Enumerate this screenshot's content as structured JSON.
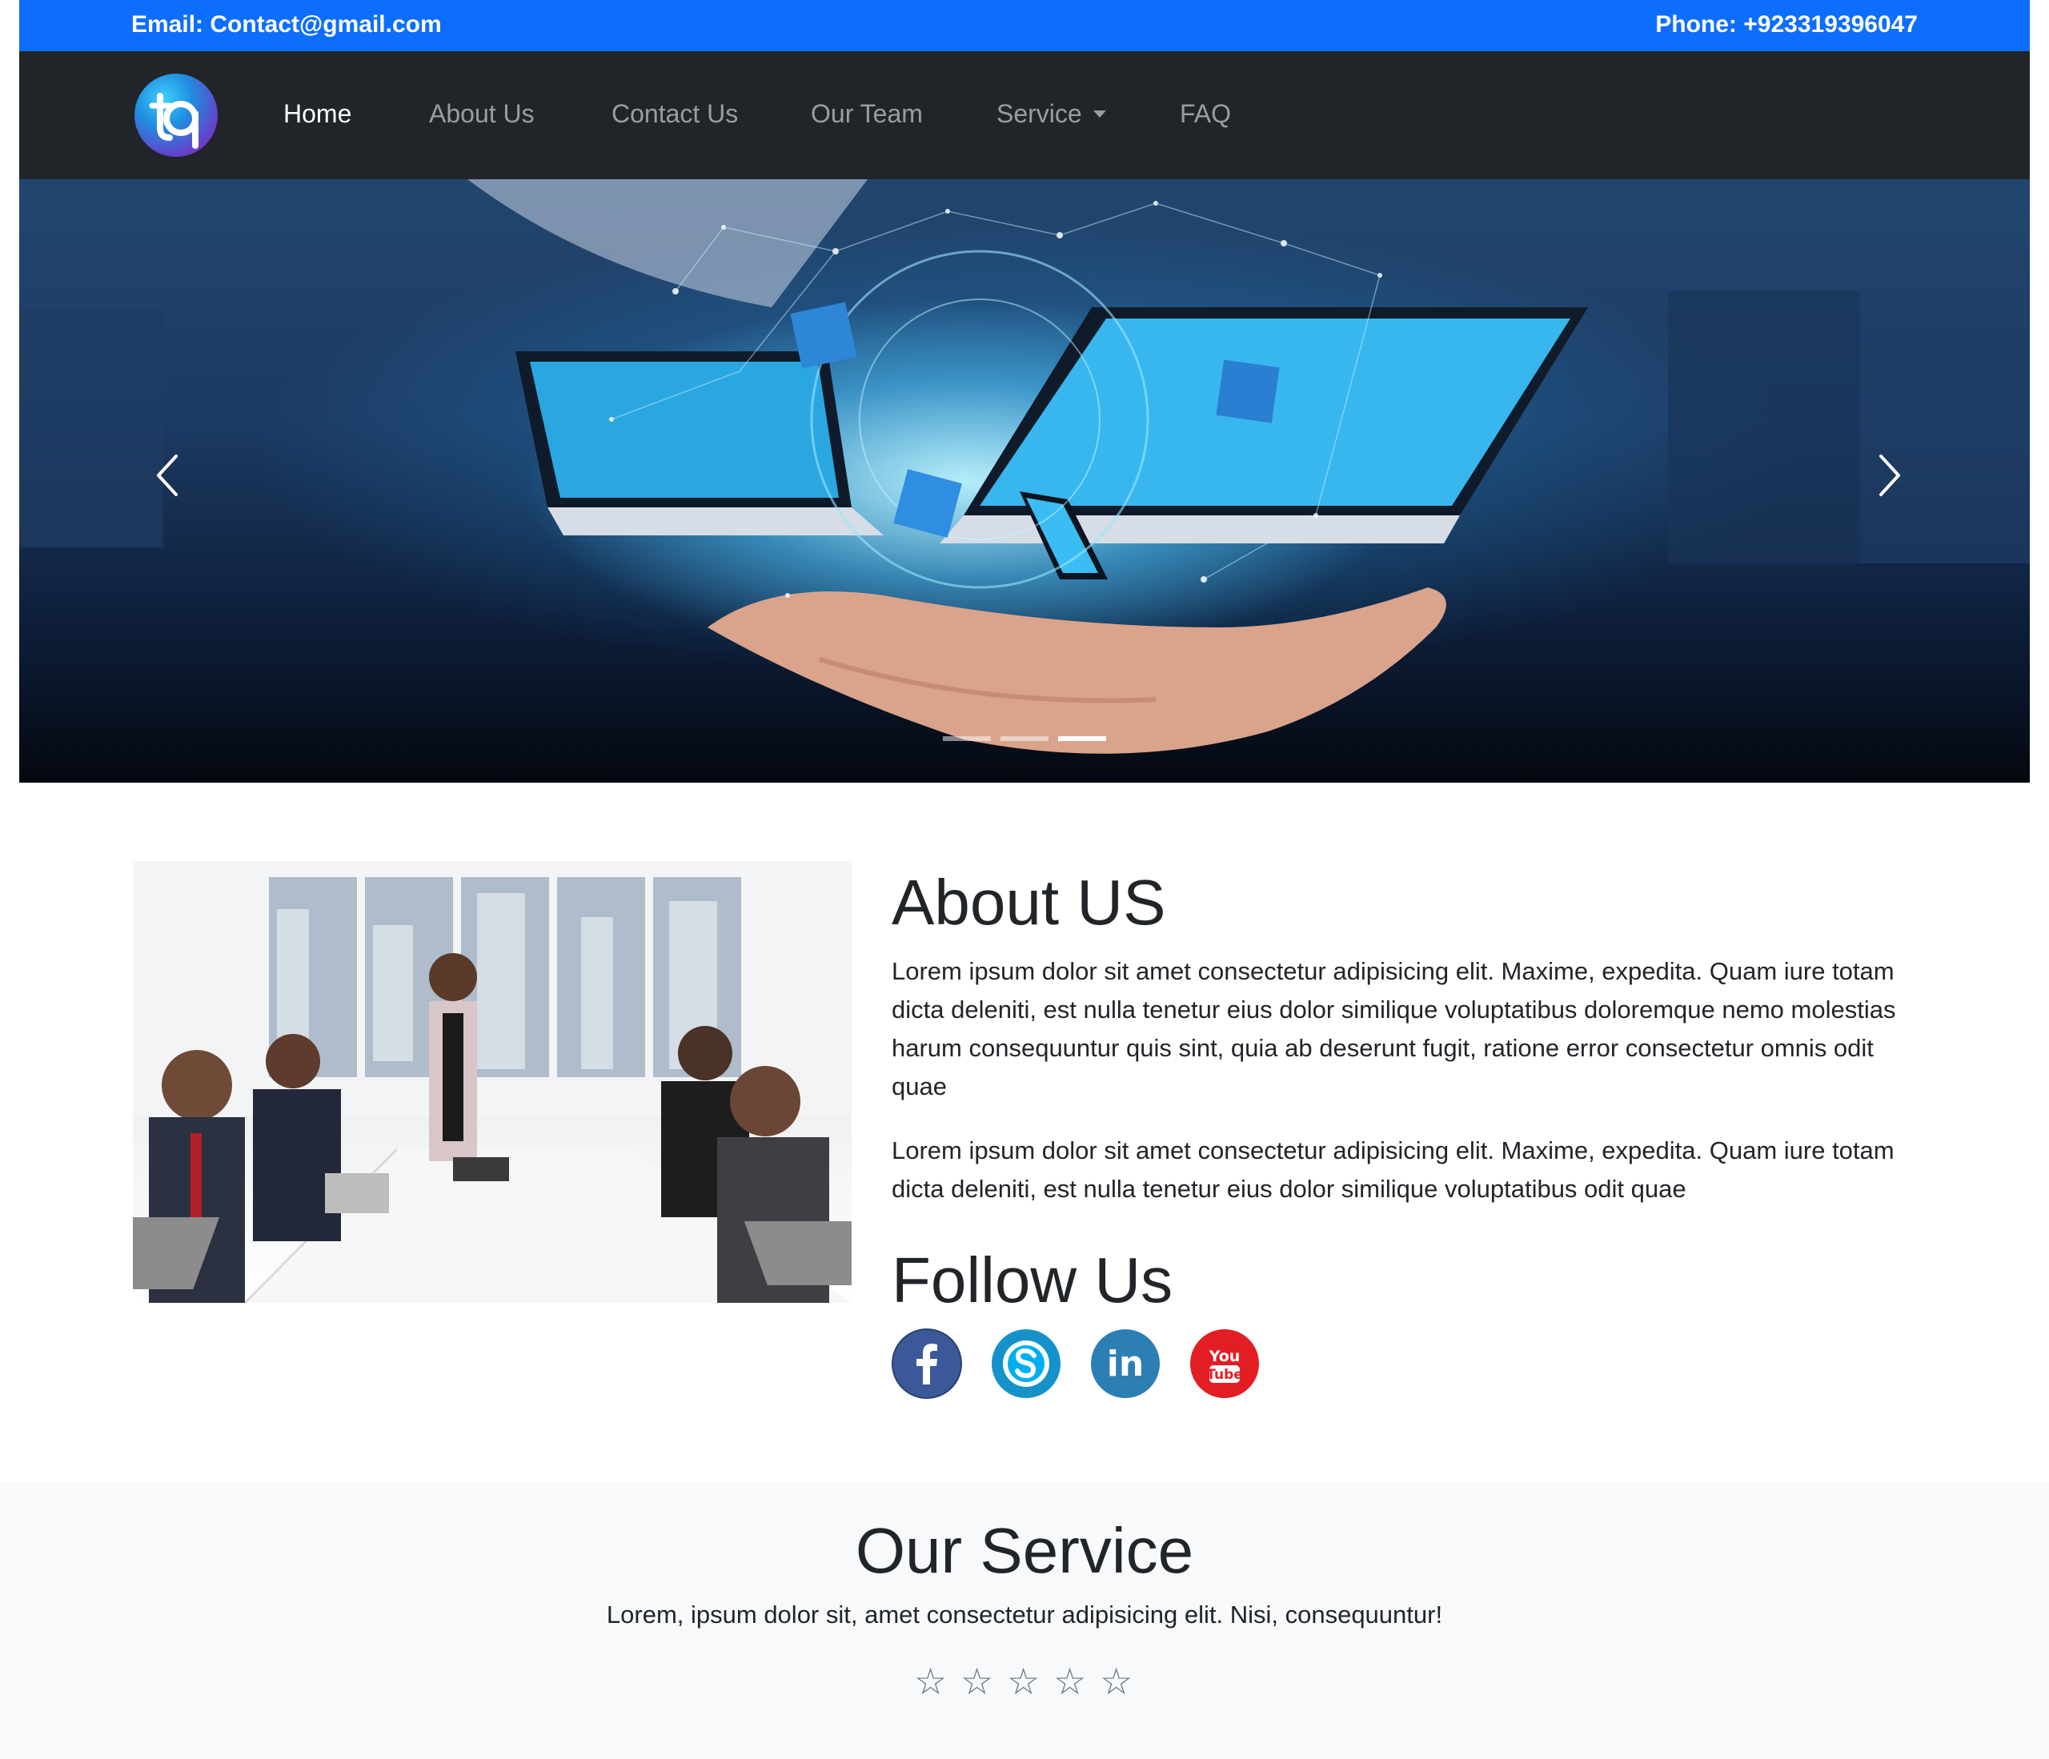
{
  "topbar": {
    "email": "Email: Contact@gmail.com",
    "phone": "Phone: +923319396047"
  },
  "navbar": {
    "logo_icon": "tq-logo-icon",
    "links": [
      {
        "label": "Home",
        "active": true
      },
      {
        "label": "About Us",
        "active": false
      },
      {
        "label": "Contact Us",
        "active": false
      },
      {
        "label": "Our Team",
        "active": false
      },
      {
        "label": "Service",
        "active": false,
        "dropdown": true
      },
      {
        "label": "FAQ",
        "active": false
      }
    ]
  },
  "carousel": {
    "slide_count": 3,
    "active_slide": 3,
    "prev_icon": "chevron-left-icon",
    "next_icon": "chevron-right-icon"
  },
  "about": {
    "title": "About US",
    "paragraphs": [
      "Lorem ipsum dolor sit amet consectetur adipisicing elit. Maxime, expedita. Quam iure totam dicta deleniti, est nulla tenetur eius dolor similique voluptatibus doloremque nemo molestias harum consequuntur quis sint, quia ab deserunt fugit, ratione error consectetur omnis odit quae",
      "Lorem ipsum dolor sit amet consectetur adipisicing elit. Maxime, expedita. Quam iure totam dicta deleniti, est nulla tenetur eius dolor similique voluptatibus odit quae"
    ]
  },
  "follow": {
    "title": "Follow Us",
    "icons": [
      "facebook-icon",
      "skype-icon",
      "linkedin-icon",
      "youtube-icon"
    ],
    "youtube_text_top": "You",
    "youtube_text_bottom": "Tube"
  },
  "services": {
    "title": "Our Service",
    "text": "Lorem, ipsum dolor sit, amet consectetur adipisicing elit. Nisi, consequuntur!",
    "rating": {
      "filled": 0,
      "total": 5,
      "glyph": "☆"
    }
  },
  "colors": {
    "topbar": "#0d6efd",
    "navbar": "#212529",
    "services_bg": "#f8f9fa",
    "facebook": "#3b5998",
    "skype": "#00aff0",
    "linkedin": "#0e76a8",
    "youtube": "#e21d24"
  }
}
